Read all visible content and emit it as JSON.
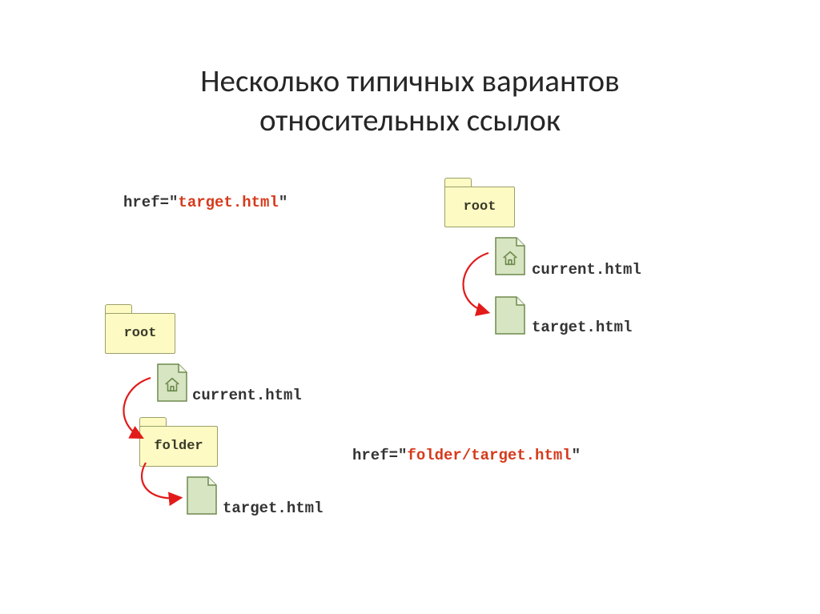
{
  "title_line1": "Несколько типичных вариантов",
  "title_line2": "относительных ссылок",
  "href1_prefix": "href=\"",
  "href1_value": "target.html",
  "href1_suffix": "\"",
  "href2_prefix": "href=\"",
  "href2_value": "folder/target.html",
  "href2_suffix": "\"",
  "root_label": "root",
  "folder_label": "folder",
  "current_html": "current.html",
  "target_html": "target.html"
}
